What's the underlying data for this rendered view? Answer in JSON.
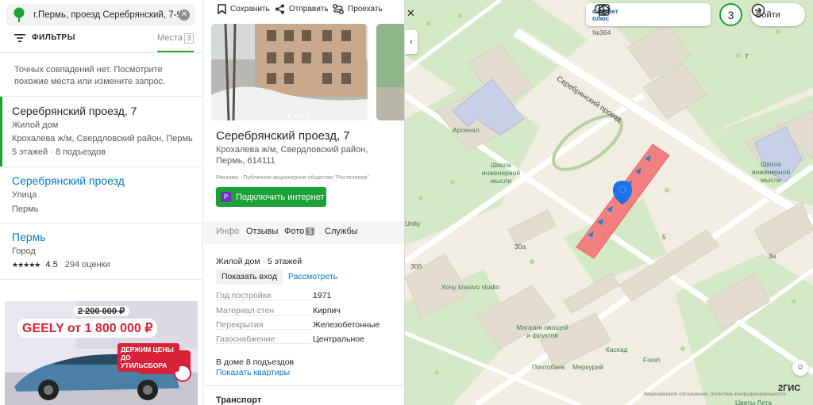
{
  "search": {
    "query": "г.Пермь, проезд Серебрянский, 7-9",
    "clear_icon": "close-icon"
  },
  "filters": {
    "label": "ФИЛЬТРЫ",
    "places_tab": "Места",
    "places_count": "3"
  },
  "notice": "Точных совпадений нет. Посмотрите похожие места или измените запрос.",
  "results": [
    {
      "title": "Серебрянский проезд, 7",
      "type": "Жилой дом",
      "address": "Крохалева ж/м, Свердловский район, Пермь",
      "meta": "5 этажей · 8 подъездов"
    },
    {
      "title": "Серебрянский проезд",
      "type": "Улица",
      "address": "Пермь"
    },
    {
      "title": "Пермь",
      "type": "Город",
      "stars": "★★★★★",
      "rating": "4.5",
      "reviews": "294 оценки"
    }
  ],
  "ad_banner": {
    "old_price": "2 200 000 ₽",
    "headline": "GEELY от 1 800 000 ₽",
    "promo": "ДЕРЖИМ ЦЕНЫ ДО УТИЛЬСБОРА"
  },
  "card": {
    "actions": {
      "save": "Сохранить",
      "share": "Отправить",
      "route": "Проехать"
    },
    "title": "Серебрянский проезд, 7",
    "address": "Крохалева ж/м, Свердловский район, Пермь, 614111",
    "ad_note": "Реклама · Публичное акционерное общество \"Ростелеком\"",
    "connect_button": "Подключить интернет",
    "tabs": {
      "info": "Инфо",
      "branches": "Отзывы",
      "photos": "Фото",
      "photos_count": "5",
      "services": "Службы"
    },
    "building_type": "Жилой дом",
    "floors": "5 этажей",
    "entrance_button": "Показать вход",
    "view_button": "Рассмотреть",
    "details": [
      {
        "label": "Год постройки",
        "value": "1971"
      },
      {
        "label": "Материал стен",
        "value": "Кирпич"
      },
      {
        "label": "Перекрытия",
        "value": "Железобетонные"
      },
      {
        "label": "Газоснабжение",
        "value": "Центральное"
      }
    ],
    "entrances": "В доме 8 подъездов",
    "show_apartments": "Показать квартиры",
    "transport": "Транспорт"
  },
  "map": {
    "top_bar": {
      "promo": "самолет плюс",
      "count": "3",
      "login": "Войти"
    },
    "labels": {
      "street": "Серебрянский проезд",
      "school": "Школа инженерной мысли",
      "school2": "Школа инженерной мысли",
      "arsenal": "Арсенал",
      "number364": "№364",
      "shop": "Магазин овощей и фруктов",
      "studio": "Хочу krasivo studio",
      "pochtabank": "Почтобанк",
      "merkuriy": "Меркурий",
      "kaskad": "Каскад",
      "fresh": "Fresh",
      "tsvety": "Цветы Лета",
      "unity": "Unity",
      "n30a": "30а",
      "n30b": "30б",
      "n5": "5",
      "n3a": "3а",
      "n7": "7",
      "copyright": "Лицензионное соглашение, политика конфиденциальности",
      "brand": "2ГИС"
    },
    "colors": {
      "highlight": "#f28080",
      "marker": "#1a73e8",
      "brand_green": "#1ba136"
    }
  }
}
